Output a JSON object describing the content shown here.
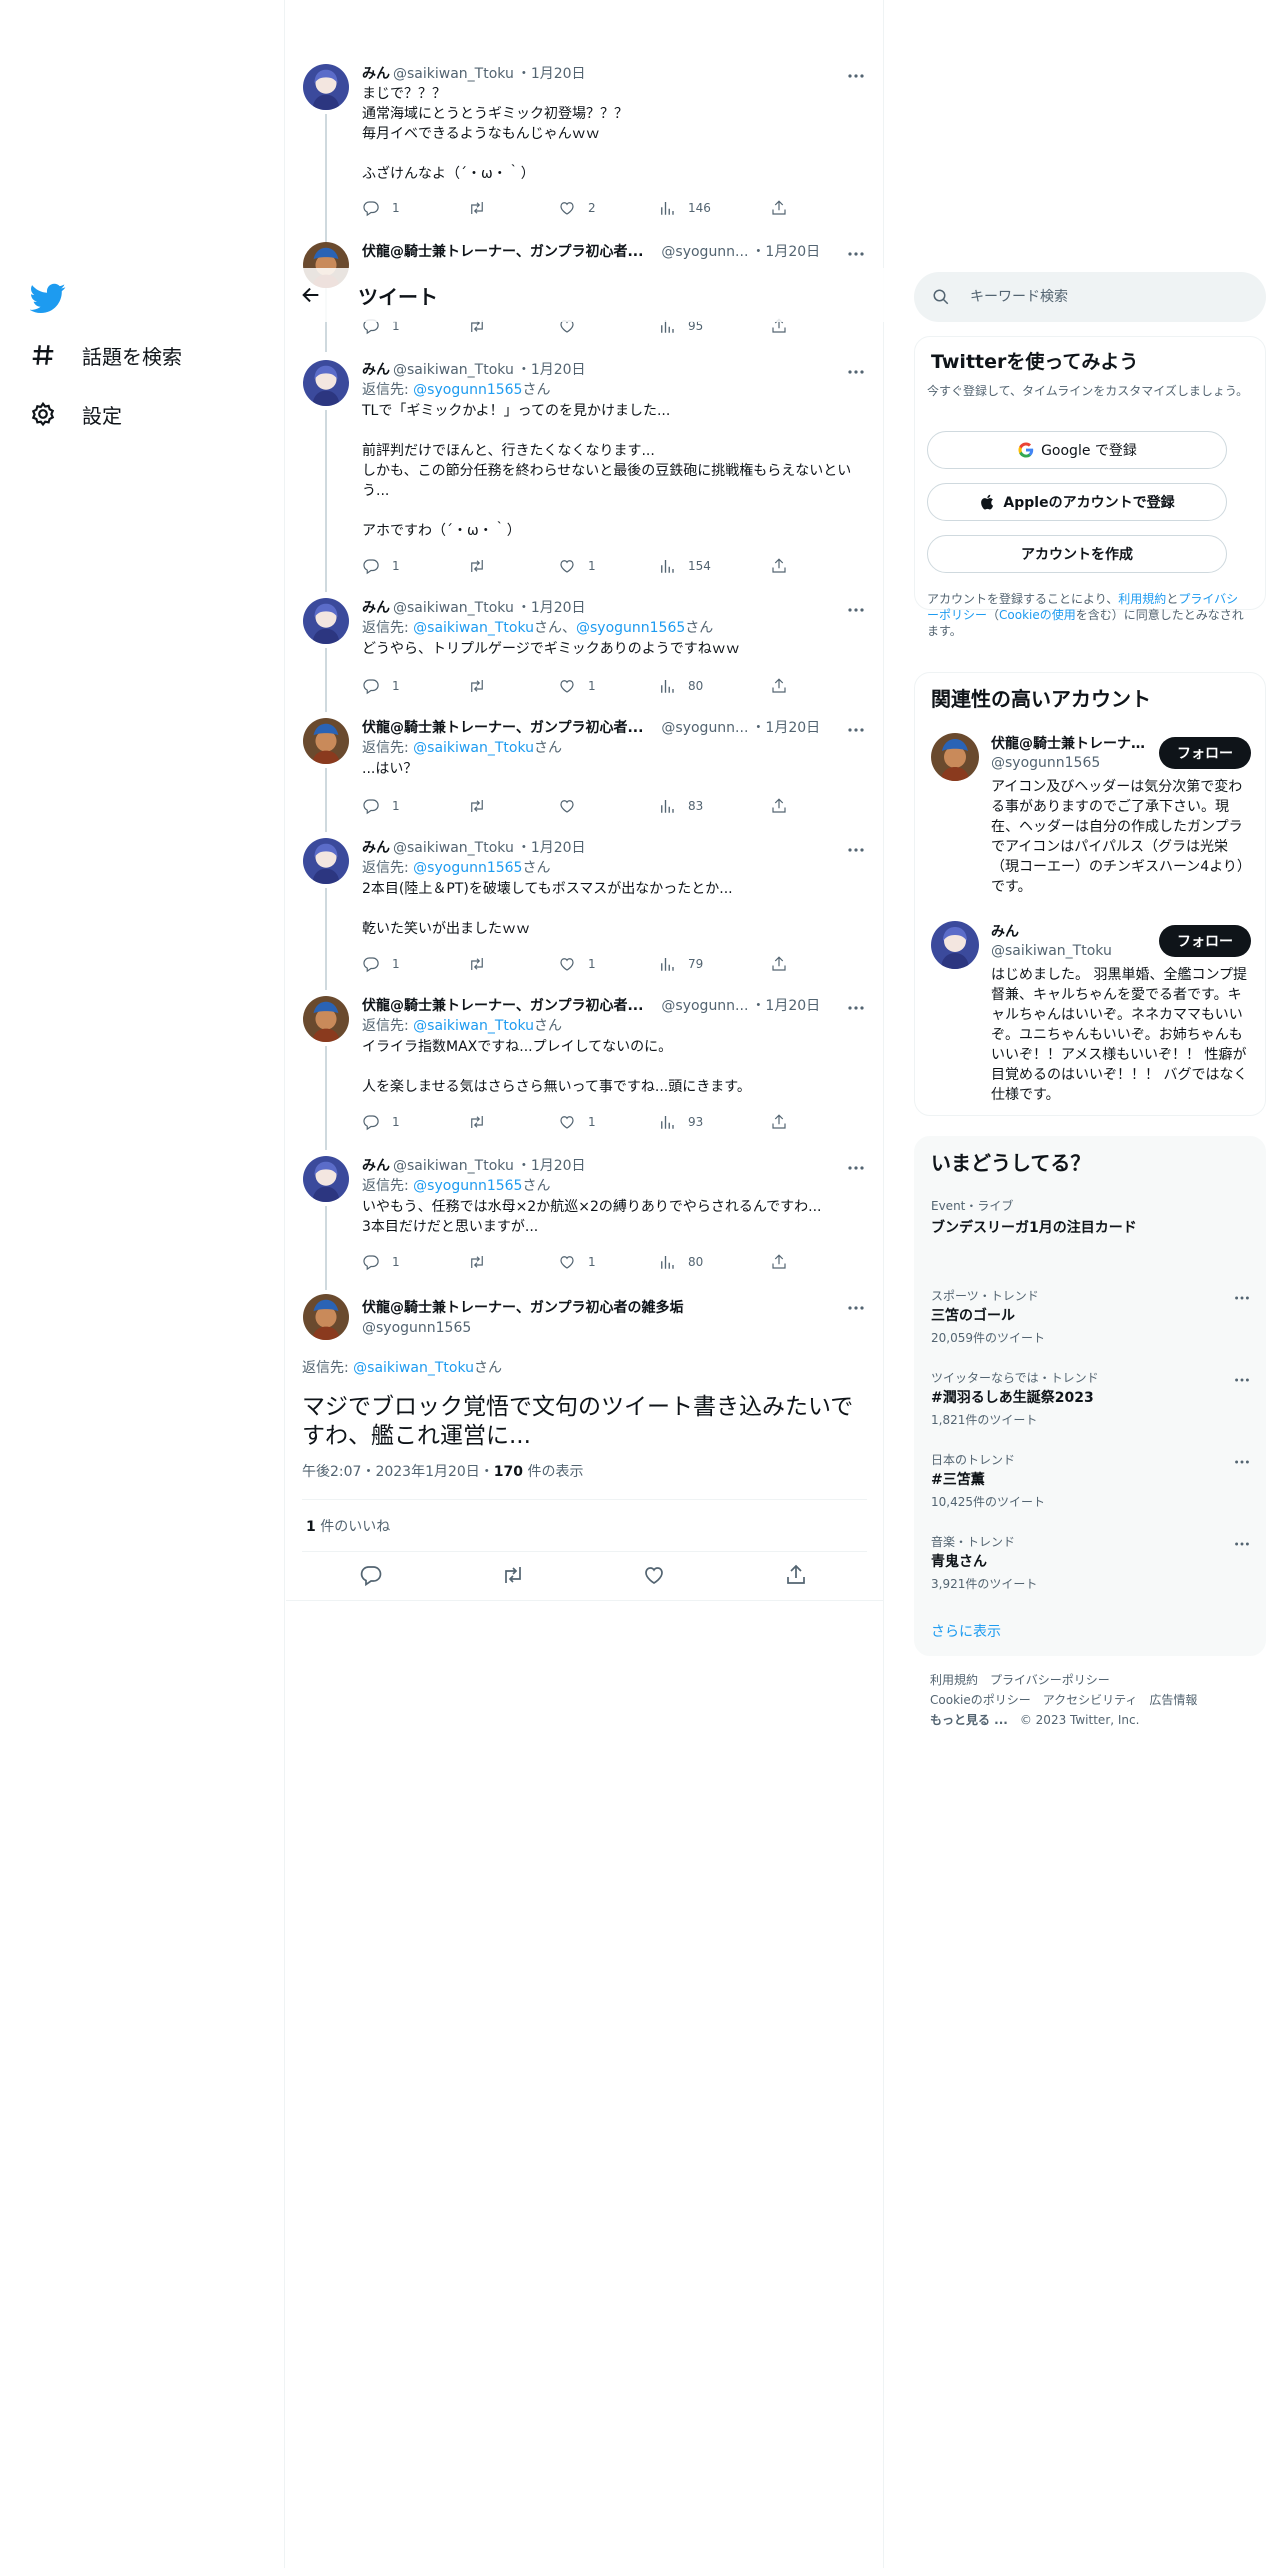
{
  "nav": {
    "explore": "話題を検索",
    "settings": "設定"
  },
  "header": {
    "title": "ツイート"
  },
  "tweets": [
    {
      "name": "みん",
      "handle": "@saikiwan_Ttoku",
      "date": "・1月20日",
      "reply_to": "",
      "text": "まじで？？？\n通常海域にとうとうギミック初登場？？？\n毎月イベできるようなもんじゃんｗｗ\n\nふざけんなよ（´・ω・｀）",
      "replies": "1",
      "retweets": "",
      "likes": "2",
      "views": "146"
    },
    {
      "name": "伏龍@騎士兼トレーナー、ガンプラ初心者...",
      "handle": "@syogunn...",
      "date": "・1月20日",
      "reply_to": "",
      "text": "",
      "replies": "1",
      "retweets": "",
      "likes": "",
      "views": "95"
    },
    {
      "name": "みん",
      "handle": "@saikiwan_Ttoku",
      "date": "・1月20日",
      "reply_prefix": "返信先: ",
      "reply_link": "@syogunn1565",
      "reply_suffix": "さん",
      "text": "TLで「ギミックかよ！」ってのを見かけました...\n\n前評判だけでほんと、行きたくなくなります...\nしかも、この節分任務を終わらせないと最後の豆鉄砲に挑戦権もらえないという...\n\nアホですわ（´・ω・｀）",
      "replies": "1",
      "retweets": "",
      "likes": "1",
      "views": "154"
    },
    {
      "name": "みん",
      "handle": "@saikiwan_Ttoku",
      "date": "・1月20日",
      "reply_prefix": "返信先: ",
      "reply_link": "@saikiwan_Ttoku",
      "reply_mid": "さん、",
      "reply_link2": "@syogunn1565",
      "reply_suffix": "さん",
      "text": "どうやら、トリプルゲージでギミックありのようですねｗｗ",
      "replies": "1",
      "retweets": "",
      "likes": "1",
      "views": "80"
    },
    {
      "name": "伏龍@騎士兼トレーナー、ガンプラ初心者...",
      "handle": "@syogunn...",
      "date": "・1月20日",
      "reply_prefix": "返信先: ",
      "reply_link": "@saikiwan_Ttoku",
      "reply_suffix": "さん",
      "text": "...はい？",
      "replies": "1",
      "retweets": "",
      "likes": "",
      "views": "83"
    },
    {
      "name": "みん",
      "handle": "@saikiwan_Ttoku",
      "date": "・1月20日",
      "reply_prefix": "返信先: ",
      "reply_link": "@syogunn1565",
      "reply_suffix": "さん",
      "text": "2本目(陸上＆PT)を破壊してもボスマスが出なかったとか...\n\n乾いた笑いが出ましたｗｗ",
      "replies": "1",
      "retweets": "",
      "likes": "1",
      "views": "79"
    },
    {
      "name": "伏龍@騎士兼トレーナー、ガンプラ初心者...",
      "handle": "@syogunn...",
      "date": "・1月20日",
      "reply_prefix": "返信先: ",
      "reply_link": "@saikiwan_Ttoku",
      "reply_suffix": "さん",
      "text": "イライラ指数MAXですね...プレイしてないのに。\n\n人を楽しませる気はさらさら無いって事ですね...頭にきます。",
      "replies": "1",
      "retweets": "",
      "likes": "1",
      "views": "93"
    },
    {
      "name": "みん",
      "handle": "@saikiwan_Ttoku",
      "date": "・1月20日",
      "reply_prefix": "返信先: ",
      "reply_link": "@syogunn1565",
      "reply_suffix": "さん",
      "text": "いやもう、任務では水母×2か航巡×2の縛りありでやらされるんですわ...\n3本目だけだと思いますが...",
      "replies": "1",
      "retweets": "",
      "likes": "1",
      "views": "80"
    }
  ],
  "focus": {
    "name": "伏龍@騎士兼トレーナー、ガンプラ初心者の雑多垢",
    "handle": "@syogunn1565",
    "reply_prefix": "返信先: ",
    "reply_link": "@saikiwan_Ttoku",
    "reply_suffix": "さん",
    "text": "マジでブロック覚悟で文句のツイート書き込みたいですわ、艦これ運営に...",
    "time": "午後2:07・2023年1月20日・",
    "views_count": "170",
    "views_label": " 件の表示",
    "likes_count": "1",
    "likes_label": " 件のいいね"
  },
  "search": {
    "placeholder": "キーワード検索"
  },
  "signup": {
    "title": "Twitterを使ってみよう",
    "subtitle": "今すぐ登録して、タイムラインをカスタマイズしましょう。",
    "google": "Google で登録",
    "apple": "Appleのアカウントで登録",
    "create": "アカウントを作成",
    "terms_a": "アカウントを登録することにより、",
    "terms_link1": "利用規約",
    "terms_b": "と",
    "terms_link2": "プライバシーポリシー",
    "terms_c": "（",
    "terms_link3": "Cookieの使用",
    "terms_d": "を含む）に同意したとみなされます。"
  },
  "related": {
    "title": "関連性の高いアカウント",
    "accounts": [
      {
        "name": "伏龍@騎士兼トレーナー、ガンプラ初心者の雑多垢",
        "handle": "@syogunn1565",
        "follow": "フォロー",
        "bio": "アイコン及びヘッダーは気分次第で変わる事がありますのでご了承下さい。現在、ヘッダーは自分の作成したガンプラでアイコンはパイパルス（グラは光栄（現コーエー）のチンギスハーン4より）です。"
      },
      {
        "name": "みん",
        "handle": "@saikiwan_Ttoku",
        "follow": "フォロー",
        "bio": "はじめました。 羽黒単婚、全艦コンプ提督兼、キャルちゃんを愛でる者です。キャルちゃんはいいぞ。ネネカママもいいぞ。ユニちゃんもいいぞ。お姉ちゃんもいいぞ！！アメス様もいいぞ！！ 性癖が目覚めるのはいいぞ！！！ バグではなく仕様です。"
      }
    ]
  },
  "trends": {
    "title": "いまどうしてる？",
    "event": {
      "meta": "Event・ライブ",
      "name": "ブンデスリーガ1月の注目カード"
    },
    "items": [
      {
        "meta": "スポーツ・トレンド",
        "name": "三笘のゴール",
        "count": "20,059件のツイート"
      },
      {
        "meta": "ツイッターならでは・トレンド",
        "name": "#潤羽るしあ生誕祭2023",
        "count": "1,821件のツイート"
      },
      {
        "meta": "日本のトレンド",
        "name": "#三笘薫",
        "count": "10,425件のツイート"
      },
      {
        "meta": "音楽・トレンド",
        "name": "青鬼さん",
        "count": "3,921件のツイート"
      }
    ],
    "show_more": "さらに表示"
  },
  "footer": {
    "links": [
      "利用規約",
      "プライバシーポリシー",
      "Cookieのポリシー",
      "アクセシビリティ",
      "広告情報",
      "もっと見る ..."
    ],
    "copyright": "© 2023 Twitter, Inc."
  },
  "colors": {
    "accent": "#1d9bf0",
    "text": "#0f1419",
    "secondary": "#536471",
    "border": "#eff3f4"
  }
}
